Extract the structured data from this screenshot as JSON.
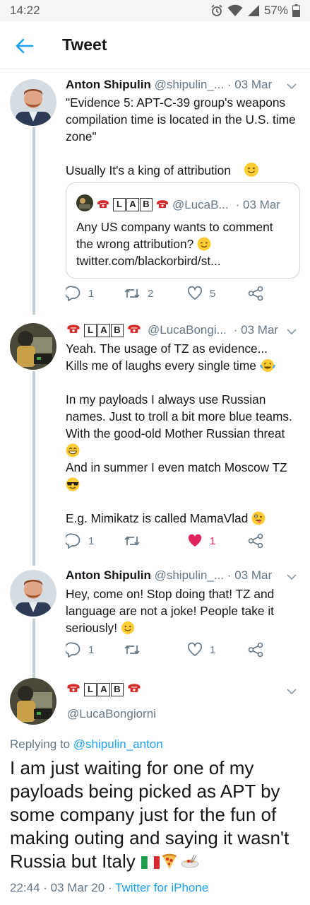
{
  "status_bar": {
    "time": "14:22",
    "battery": "57%"
  },
  "header": {
    "title": "Tweet"
  },
  "tweets": [
    {
      "name": "Anton Shipulin",
      "handle": "@shipulin_...",
      "date": "· 03 Mar",
      "text": "\"Evidence 5: APT-C-39 group's weapons compilation time is located in the U.S. time zone\"\n\nUsually It's a king of attribution",
      "quote": {
        "handle": "@LucaB...",
        "date": "· 03 Mar",
        "text": "Any US company wants to comment the wrong attribution?",
        "link": "twitter.com/blackorbird/st..."
      },
      "replies": "1",
      "retweets": "2",
      "likes": "5"
    },
    {
      "lab": "LAB",
      "handle": "@LucaBongi...",
      "date": "· 03 Mar",
      "text_1": "Yeah. The usage of TZ as evidence...\nKills me of laughs every single time",
      "text_2": "In my payloads I always use Russian names. Just to troll a bit more blue teams. With the good-old Mother Russian threat",
      "text_3": "And in summer I even match Moscow TZ",
      "text_4": "E.g. Mimikatz is called MamaVlad",
      "replies": "1",
      "retweets": "",
      "likes": "1"
    },
    {
      "name": "Anton Shipulin",
      "handle": "@shipulin_...",
      "date": "· 03 Mar",
      "text": "Hey, come on! Stop doing that! TZ and language are not a joke! People take it seriously!",
      "replies": "1",
      "retweets": "",
      "likes": "1"
    }
  ],
  "main_tweet": {
    "lab": "LAB",
    "handle": "@LucaBongiorni",
    "replying_prefix": "Replying to",
    "replying_to": "@shipulin_anton",
    "text": "I am just waiting for one of my payloads being picked as APT by some company just for the fun of making outing and saying it wasn't Russia but Italy",
    "time": "22:44 · 03 Mar 20 ·",
    "source": "Twitter for iPhone"
  },
  "colors": {
    "accent": "#1da1f2",
    "like": "#e0245e",
    "muted": "#657786",
    "thread": "#c4cfd6"
  }
}
